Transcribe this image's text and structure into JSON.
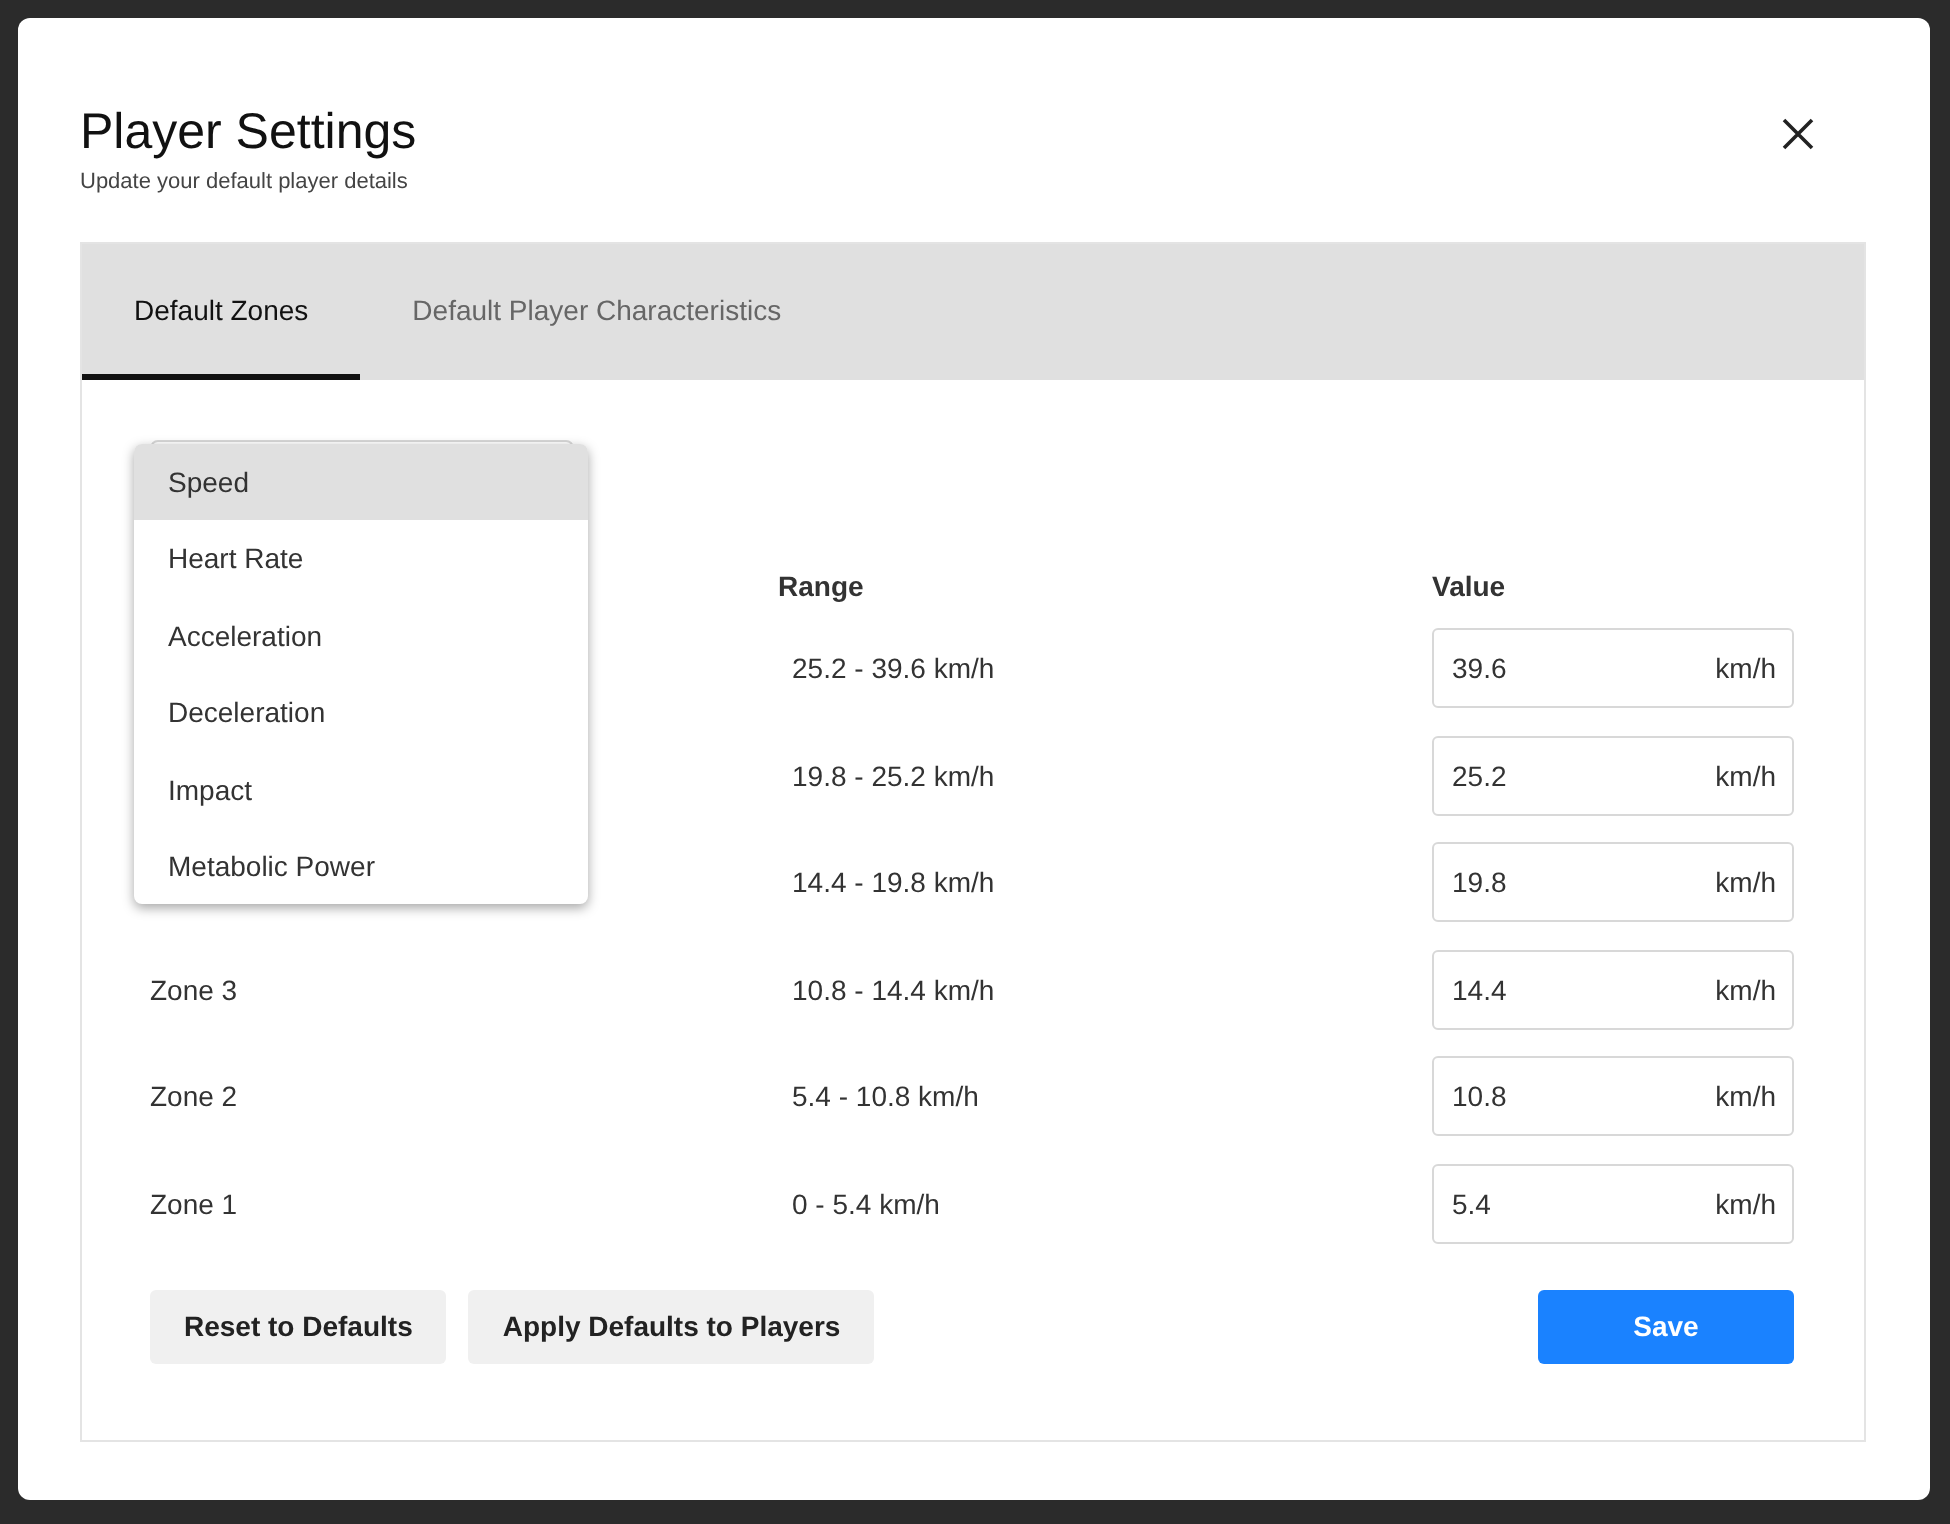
{
  "dialog": {
    "title": "Player Settings",
    "subtitle": "Update your default player details"
  },
  "tabs": [
    {
      "label": "Default Zones",
      "selected": true
    },
    {
      "label": "Default Player Characteristics",
      "selected": false
    }
  ],
  "metric_menu": {
    "expanded": true,
    "options": [
      {
        "label": "Speed",
        "selected": true
      },
      {
        "label": "Heart Rate",
        "selected": false
      },
      {
        "label": "Acceleration",
        "selected": false
      },
      {
        "label": "Deceleration",
        "selected": false
      },
      {
        "label": "Impact",
        "selected": false
      },
      {
        "label": "Metabolic Power",
        "selected": false
      }
    ]
  },
  "table": {
    "columns": [
      "Range",
      "Value"
    ],
    "rows": [
      {
        "range": "25.2 - 39.6 km/h",
        "value": "39.6",
        "unit": "km/h"
      },
      {
        "range": "19.8 - 25.2 km/h",
        "value": "25.2",
        "unit": "km/h"
      },
      {
        "range": "14.4 - 19.8 km/h",
        "value": "19.8",
        "unit": "km/h"
      },
      {
        "zone": "Zone 3",
        "range": "10.8 - 14.4 km/h",
        "value": "14.4",
        "unit": "km/h"
      },
      {
        "zone": "Zone 2",
        "range": "5.4 - 10.8 km/h",
        "value": "10.8",
        "unit": "km/h"
      },
      {
        "zone": "Zone 1",
        "range": "0 - 5.4 km/h",
        "value": "5.4",
        "unit": "km/h"
      }
    ]
  },
  "buttons": [
    {
      "label": "Reset to Defaults",
      "kind": "secondary"
    },
    {
      "label": "Apply Defaults to Players",
      "kind": "secondary"
    },
    {
      "label": "Save",
      "kind": "primary"
    }
  ]
}
